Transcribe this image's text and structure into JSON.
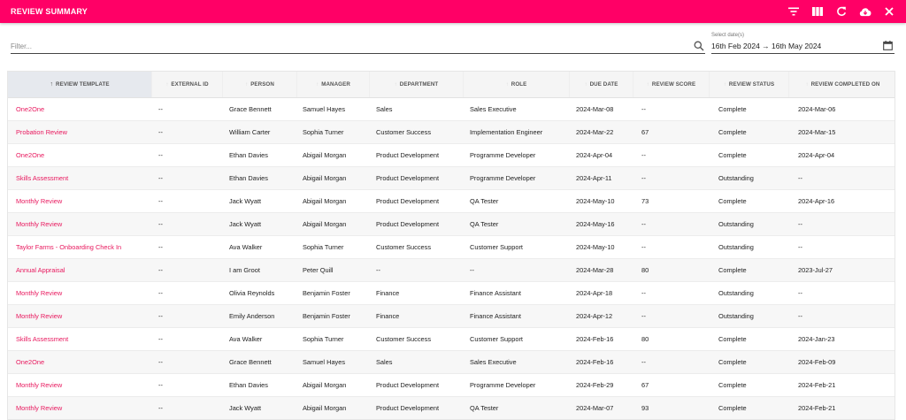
{
  "app": {
    "title": "REVIEW SUMMARY",
    "accent_color": "#ff0066",
    "actions": [
      {
        "name": "filter-icon",
        "icon": "filter"
      },
      {
        "name": "columns-icon",
        "icon": "columns"
      },
      {
        "name": "refresh-icon",
        "icon": "refresh"
      },
      {
        "name": "cloud-download-icon",
        "icon": "cloud-download"
      },
      {
        "name": "close-icon",
        "icon": "close"
      }
    ]
  },
  "filter": {
    "placeholder": "Filter...",
    "value": ""
  },
  "date_range": {
    "label": "Select date(s)",
    "value": "16th Feb 2024  →  16th May 2024"
  },
  "table": {
    "sorted_column": "REVIEW TEMPLATE",
    "columns": [
      "REVIEW TEMPLATE",
      "EXTERNAL ID",
      "PERSON",
      "MANAGER",
      "DEPARTMENT",
      "ROLE",
      "DUE DATE",
      "REVIEW SCORE",
      "REVIEW STATUS",
      "REVIEW COMPLETED ON"
    ],
    "rows": [
      [
        "One2One",
        "--",
        "Grace Bennett",
        "Samuel Hayes",
        "Sales",
        "Sales Executive",
        "2024-Mar-08",
        "--",
        "Complete",
        "2024-Mar-06"
      ],
      [
        "Probation Review",
        "--",
        "William Carter",
        "Sophia Turner",
        "Customer Success",
        "Implementation Engineer",
        "2024-Mar-22",
        "67",
        "Complete",
        "2024-Mar-15"
      ],
      [
        "One2One",
        "--",
        "Ethan Davies",
        "Abigail Morgan",
        "Product Development",
        "Programme Developer",
        "2024-Apr-04",
        "--",
        "Complete",
        "2024-Apr-04"
      ],
      [
        "Skills Assessment",
        "--",
        "Ethan Davies",
        "Abigail Morgan",
        "Product Development",
        "Programme Developer",
        "2024-Apr-11",
        "--",
        "Outstanding",
        "--"
      ],
      [
        "Monthly Review",
        "--",
        "Jack Wyatt",
        "Abigail Morgan",
        "Product Development",
        "QA Tester",
        "2024-May-10",
        "73",
        "Complete",
        "2024-Apr-16"
      ],
      [
        "Monthly Review",
        "--",
        "Jack Wyatt",
        "Abigail Morgan",
        "Product Development",
        "QA Tester",
        "2024-May-16",
        "--",
        "Outstanding",
        "--"
      ],
      [
        "Taylor Farms - Onboarding Check In",
        "--",
        "Ava Walker",
        "Sophia Turner",
        "Customer Success",
        "Customer Support",
        "2024-May-10",
        "--",
        "Outstanding",
        "--"
      ],
      [
        "Annual Appraisal",
        "--",
        "I am Groot",
        "Peter Quill",
        "--",
        "--",
        "2024-Mar-28",
        "80",
        "Complete",
        "2023-Jul-27"
      ],
      [
        "Monthly Review",
        "--",
        "Olivia Reynolds",
        "Benjamin Foster",
        "Finance",
        "Finance Assistant",
        "2024-Apr-18",
        "--",
        "Outstanding",
        "--"
      ],
      [
        "Monthly Review",
        "--",
        "Emily Anderson",
        "Benjamin Foster",
        "Finance",
        "Finance Assistant",
        "2024-Apr-12",
        "--",
        "Outstanding",
        "--"
      ],
      [
        "Skills Assessment",
        "--",
        "Ava Walker",
        "Sophia Turner",
        "Customer Success",
        "Customer Support",
        "2024-Feb-16",
        "80",
        "Complete",
        "2024-Jan-23"
      ],
      [
        "One2One",
        "--",
        "Grace Bennett",
        "Samuel Hayes",
        "Sales",
        "Sales Executive",
        "2024-Feb-16",
        "--",
        "Complete",
        "2024-Feb-09"
      ],
      [
        "Monthly Review",
        "--",
        "Ethan Davies",
        "Abigail Morgan",
        "Product Development",
        "Programme Developer",
        "2024-Feb-29",
        "67",
        "Complete",
        "2024-Feb-21"
      ],
      [
        "Monthly Review",
        "--",
        "Jack Wyatt",
        "Abigail Morgan",
        "Product Development",
        "QA Tester",
        "2024-Mar-07",
        "93",
        "Complete",
        "2024-Feb-21"
      ]
    ]
  }
}
